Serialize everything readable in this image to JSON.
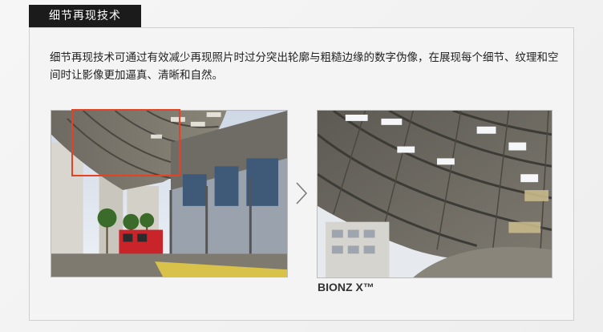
{
  "section": {
    "title": "细节再现技术",
    "description": "细节再现技术可通过有效减少再现照片时过分突出轮廓与粗糙边缘的数字伪像，在展现每个细节、纹理和空间时让影像更加逼真、清晰和自然。"
  },
  "comparison": {
    "arrow_icon": "chevron-right-icon",
    "right_caption": "BIONZ X™"
  },
  "colors": {
    "tab_bg": "#1b1b1b",
    "highlight": "#e64125",
    "panel_border": "#cfcfcf"
  }
}
